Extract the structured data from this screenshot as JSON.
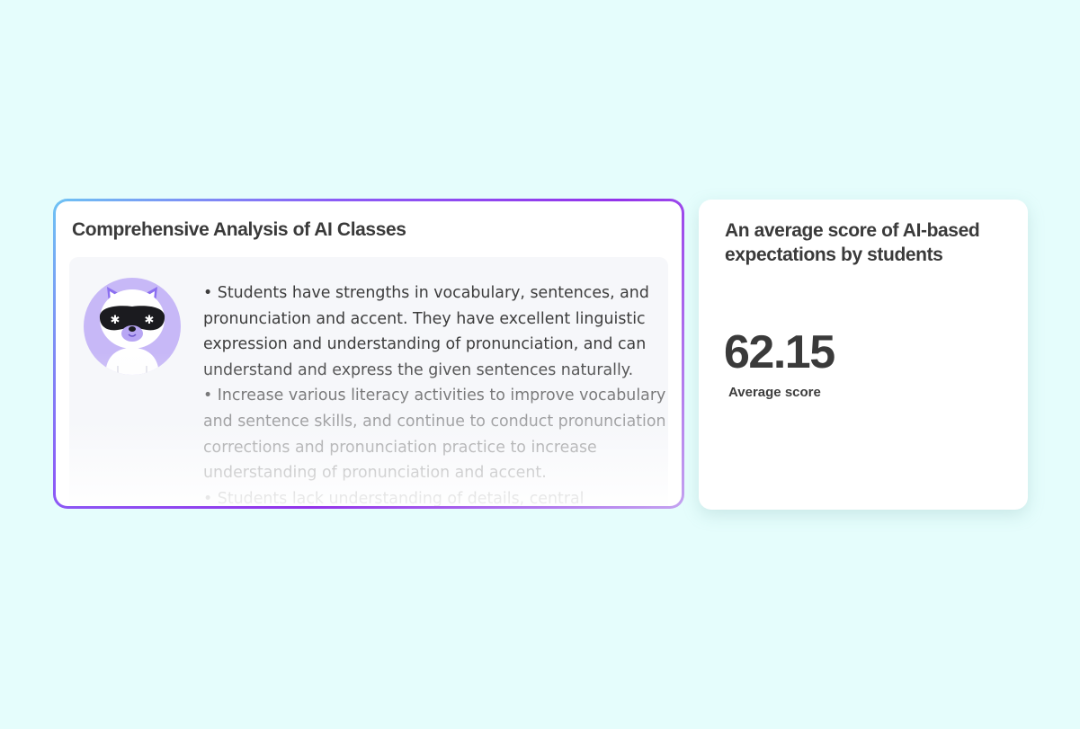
{
  "analysis": {
    "title": "Comprehensive Analysis of AI Classes",
    "avatar_icon": "panda-mascot-icon",
    "paragraphs": [
      "• Students have strengths in vocabulary, sentences, and pronunciation and accent. They have excellent linguistic expression and understanding of pronunciation, and can understand and express the given sentences naturally.",
      "• Increase various literacy activities to improve vocabulary and sentence skills, and continue to conduct pronunciation corrections and pronunciation practice to increase understanding of pronunciation and accent.",
      "• Students lack understanding of details, central"
    ]
  },
  "score": {
    "title": "An average score of AI-based expectations by students",
    "value": "62.15",
    "label": "Average score"
  },
  "colors": {
    "background": "#e5fdfc",
    "accent_purple": "#9333ea",
    "accent_blue": "#6ec3f4",
    "text_dark": "#3a3a3a",
    "mascot_purple": "#b9a8f5"
  }
}
